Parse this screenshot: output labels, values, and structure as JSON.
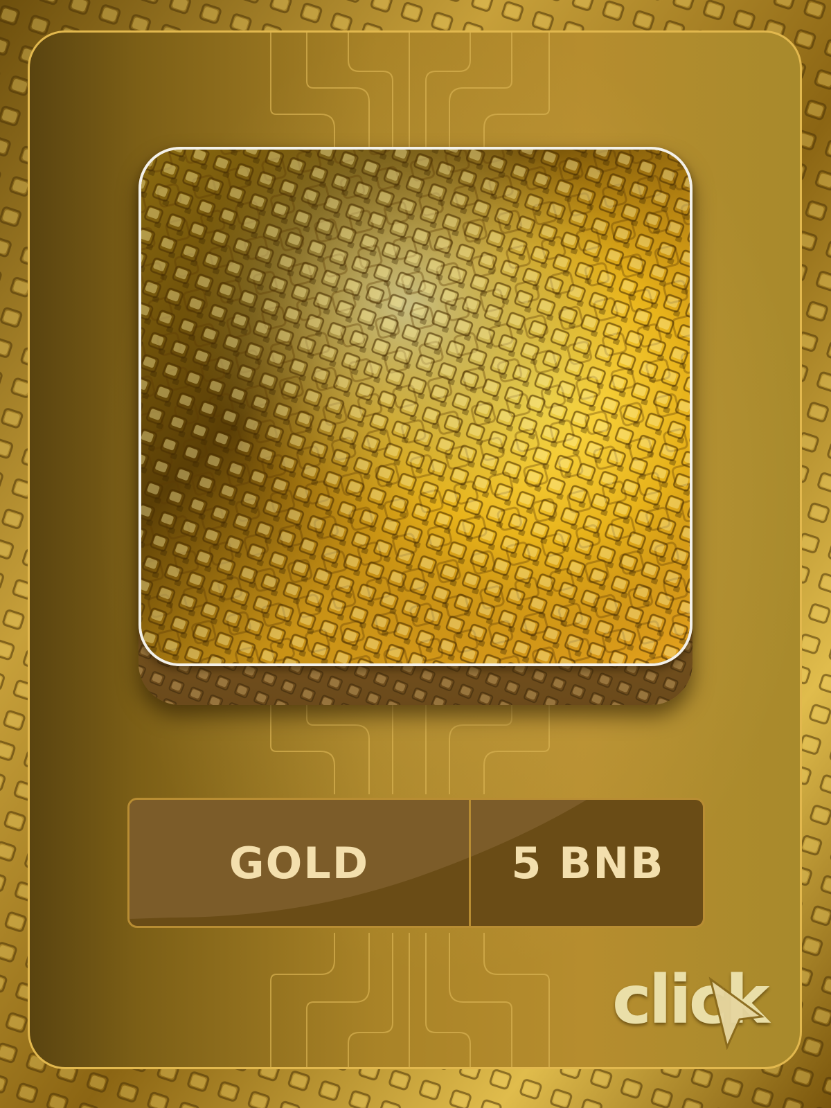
{
  "card": {
    "name": "GOLD",
    "price": "5 BNB",
    "brand": "click"
  },
  "colors": {
    "gold_border": "#e2b84e",
    "badge_bg": "#6a4c16",
    "badge_text": "#f3dfad",
    "logo_text": "#eadfa8"
  },
  "icons": [
    "gold-texture-image",
    "cursor-arrow-icon"
  ]
}
